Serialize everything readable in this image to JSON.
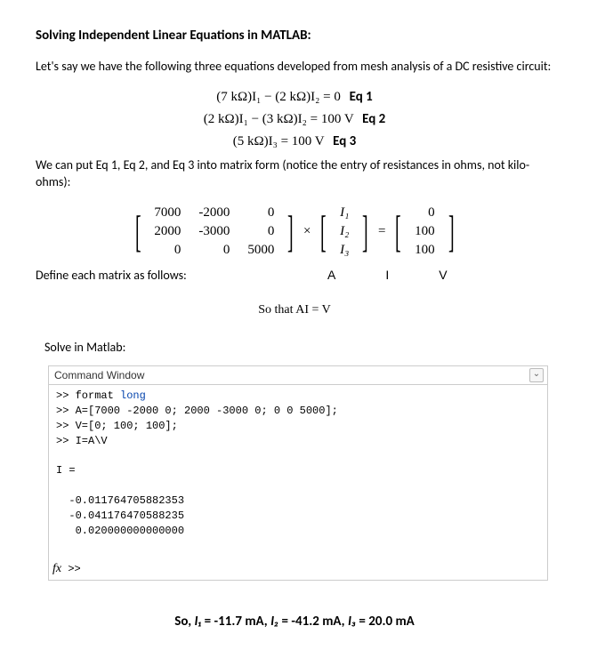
{
  "title": "Solving Independent Linear Equations in MATLAB:",
  "intro": "Let's say we have the following three equations developed from mesh analysis of a DC resistive circuit:",
  "equations": {
    "eq1": {
      "lhs": "(7 kΩ)I₁ − (2 kΩ)I₂ = 0",
      "label": "Eq 1"
    },
    "eq2": {
      "lhs": "(2 kΩ)I₁ − (3 kΩ)I₂ = 100 V",
      "label": "Eq 2"
    },
    "eq3": {
      "lhs": "(5 kΩ)I₃ = 100 V",
      "label": "Eq 3"
    }
  },
  "matrix_intro": "We can put Eq 1, Eq 2, and Eq 3 into matrix form (notice the entry of resistances in ohms, not kilo-ohms):",
  "matrix": {
    "A": [
      [
        7000,
        -2000,
        0
      ],
      [
        2000,
        -3000,
        0
      ],
      [
        0,
        0,
        5000
      ]
    ],
    "I": [
      "I₁",
      "I₂",
      "I₃"
    ],
    "V": [
      0,
      100,
      100
    ]
  },
  "define_label": "Define each matrix as follows:",
  "names": {
    "A": "A",
    "I": "I",
    "V": "V"
  },
  "sothat": "So that AI = V",
  "solve_label": "Solve in Matlab:",
  "cmdwin": {
    "title": "Command Window",
    "lines": {
      "l1pre": ">> format ",
      "l1kw": "long",
      "l2": ">> A=[7000 -2000 0; 2000 -3000 0; 0 0 5000];",
      "l3": ">> V=[0; 100; 100];",
      "l4": ">> I=A\\V",
      "blank1": " ",
      "l5": "I =",
      "blank2": " ",
      "r1": "  -0.011764705882353",
      "r2": "  -0.041176470588235",
      "r3": "   0.020000000000000",
      "blank3": " "
    },
    "fx": "fx",
    "fxprompt": ">>"
  },
  "result": {
    "prefix": "So, ",
    "i1lab": "I₁",
    "i1val": " = -11.7 mA, ",
    "i2lab": "I₂",
    "i2val": " = -41.2 mA, ",
    "i3lab": "I₃",
    "i3val": " = 20.0 mA"
  }
}
